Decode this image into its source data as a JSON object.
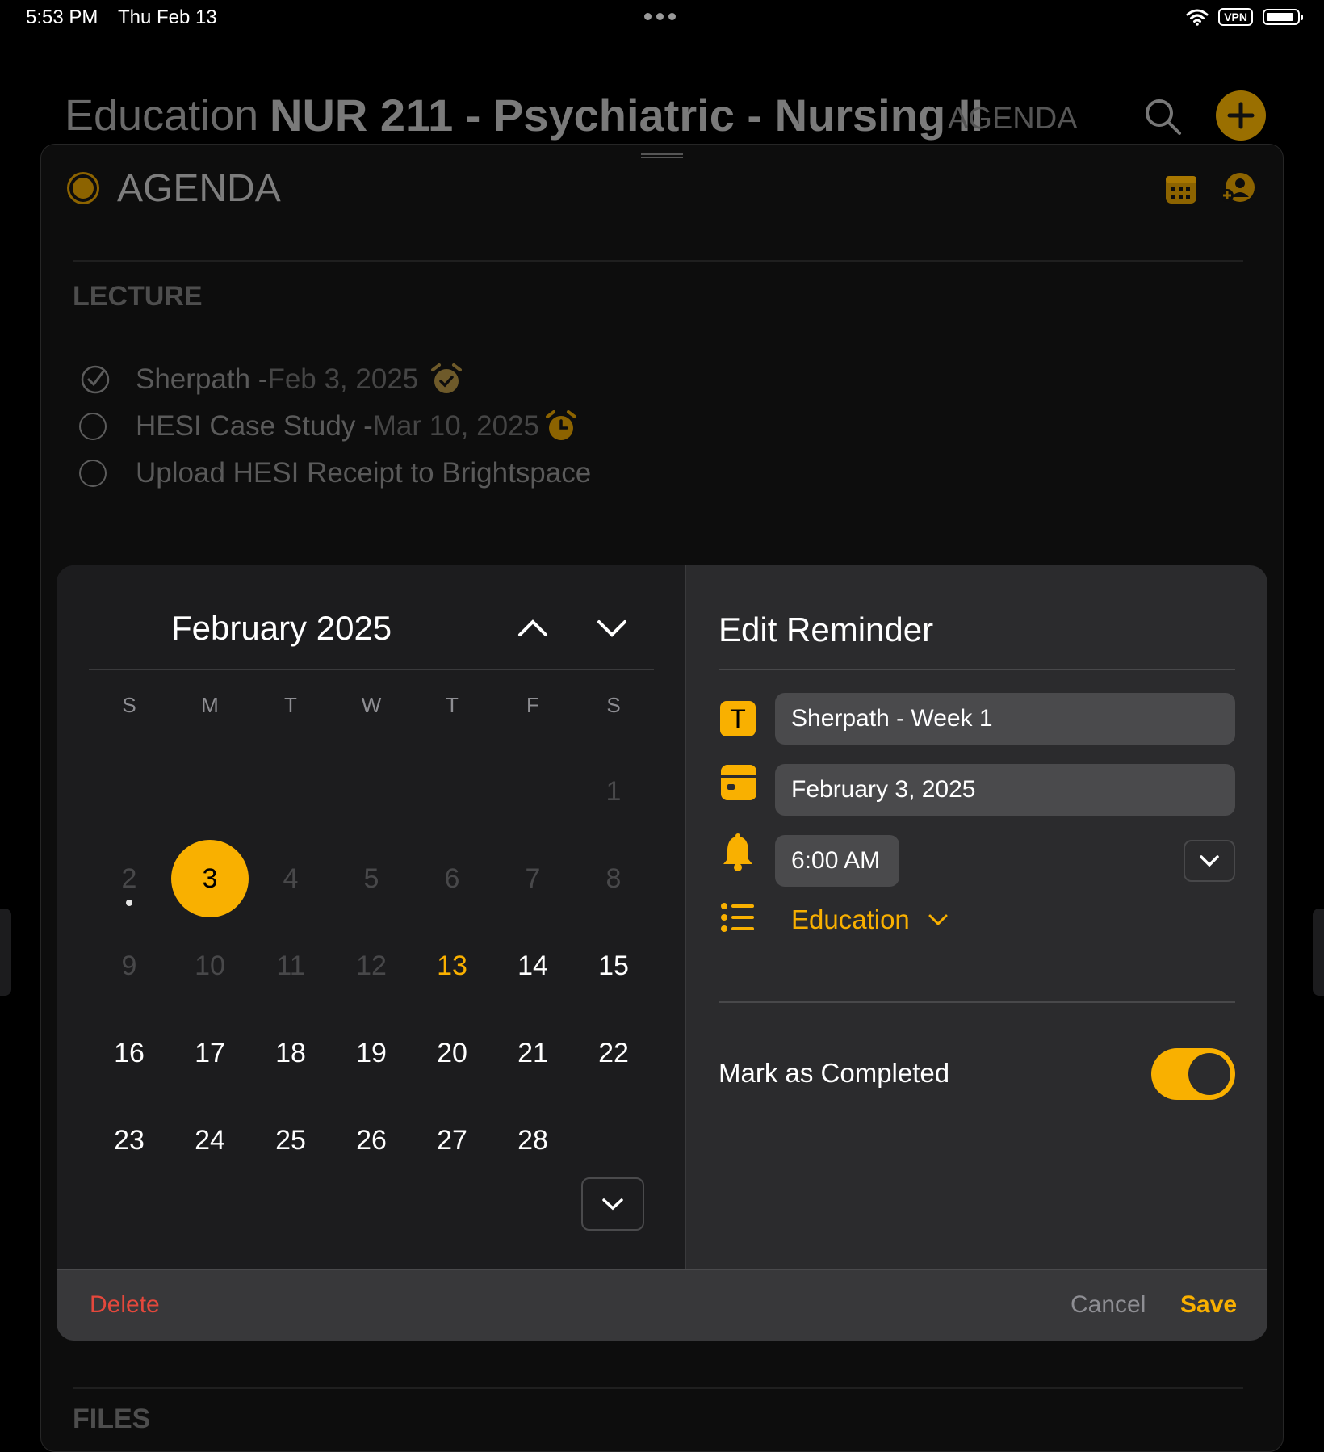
{
  "status": {
    "time": "5:53 PM",
    "date": "Thu Feb 13",
    "vpn": "VPN"
  },
  "header": {
    "category": "Education",
    "course": "NUR 211 - Psychiatric - Nursing II",
    "section": "AGENDA"
  },
  "agenda": {
    "title": "AGENDA",
    "group": "LECTURE",
    "tasks": [
      {
        "title": "Sherpath - ",
        "date": "Feb 3, 2025",
        "done": true
      },
      {
        "title": "HESI Case Study - ",
        "date": "Mar 10, 2025",
        "done": false
      },
      {
        "title": "Upload HESI Receipt to Brightspace",
        "date": "",
        "done": false
      }
    ],
    "files_label": "FILES"
  },
  "calendar": {
    "month": "February 2025",
    "weekdays": [
      "S",
      "M",
      "T",
      "W",
      "T",
      "F",
      "S"
    ],
    "days": [
      "1",
      "2",
      "3",
      "4",
      "5",
      "6",
      "7",
      "8",
      "9",
      "10",
      "11",
      "12",
      "13",
      "14",
      "15",
      "16",
      "17",
      "18",
      "19",
      "20",
      "21",
      "22",
      "23",
      "24",
      "25",
      "26",
      "27",
      "28"
    ],
    "selected": "3",
    "today": "13"
  },
  "edit": {
    "title": "Edit Reminder",
    "name": "Sherpath - Week 1",
    "date": "February 3, 2025",
    "time": "6:00 AM",
    "list": "Education",
    "mark_completed_label": "Mark as Completed",
    "completed": true
  },
  "footer": {
    "delete": "Delete",
    "cancel": "Cancel",
    "save": "Save"
  },
  "colors": {
    "accent": "#f9b000",
    "danger": "#e5483c"
  }
}
